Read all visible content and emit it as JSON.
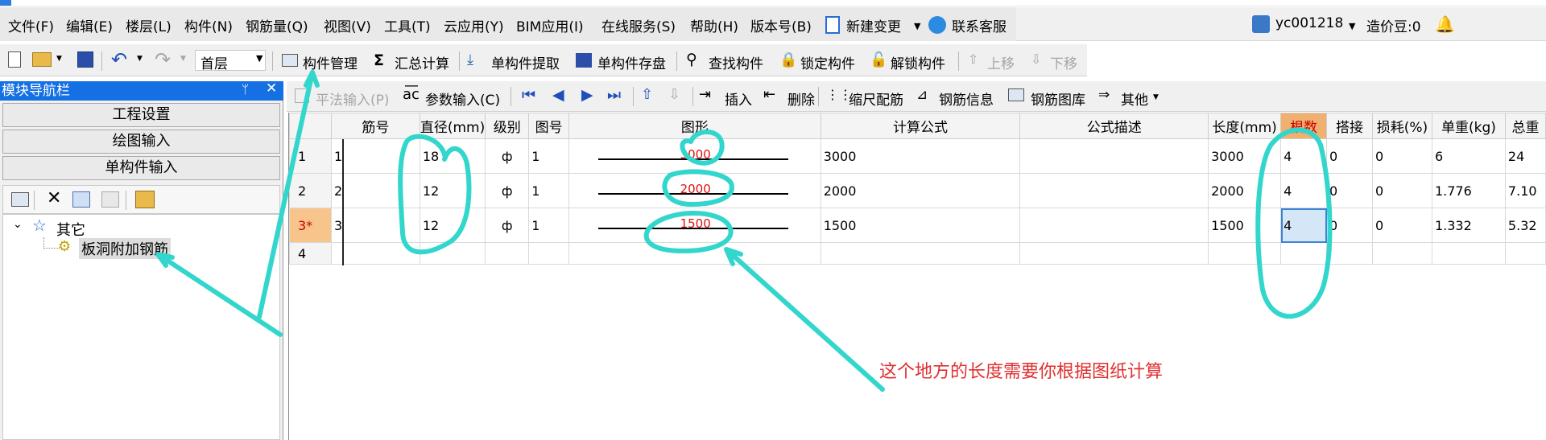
{
  "menu": {
    "items": [
      "文件(F)",
      "编辑(E)",
      "楼层(L)",
      "构件(N)",
      "钢筋量(Q)",
      "视图(V)",
      "工具(T)",
      "云应用(Y)",
      "BIM应用(I)",
      "在线服务(S)",
      "帮助(H)",
      "版本号(B)",
      "新建变更",
      "联系客服"
    ],
    "user": "yc001218",
    "cost_beans": "造价豆:0"
  },
  "toolbar": {
    "floor": "首层",
    "component_manage": "构件管理",
    "summary_calc": "汇总计算",
    "single_extract": "单构件提取",
    "single_save": "单构件存盘",
    "find_component": "查找构件",
    "lock_component": "锁定构件",
    "unlock_component": "解锁构件",
    "move_up": "上移",
    "move_down": "下移"
  },
  "left_panel": {
    "title": "模块导航栏",
    "buttons": [
      "工程设置",
      "绘图输入",
      "单构件输入"
    ],
    "tree": {
      "root": "其它",
      "child": "板洞附加钢筋"
    }
  },
  "grid_toolbar": {
    "flat_input": "平法输入(P)",
    "param_input": "参数输入(C)",
    "insert": "插入",
    "delete": "删除",
    "scale_rebar": "缩尺配筋",
    "rebar_info": "钢筋信息",
    "rebar_library": "钢筋图库",
    "other": "其他"
  },
  "table": {
    "columns": [
      "",
      "筋号",
      "直径(mm)",
      "级别",
      "图号",
      "图形",
      "计算公式",
      "公式描述",
      "长度(mm)",
      "根数",
      "搭接",
      "损耗(%)",
      "单重(kg)",
      "总重"
    ],
    "rows": [
      {
        "row": "1",
        "bar_no": "1",
        "diameter": "18",
        "grade": "ф",
        "fig_no": "1",
        "shape": "3000",
        "formula": "3000",
        "desc": "",
        "length": "3000",
        "count": "4",
        "lap": "0",
        "loss": "0",
        "unit_wt": "6",
        "total_wt": "24"
      },
      {
        "row": "2",
        "bar_no": "2",
        "diameter": "12",
        "grade": "ф",
        "fig_no": "1",
        "shape": "2000",
        "formula": "2000",
        "desc": "",
        "length": "2000",
        "count": "4",
        "lap": "0",
        "loss": "0",
        "unit_wt": "1.776",
        "total_wt": "7.10"
      },
      {
        "row": "3*",
        "bar_no": "3",
        "diameter": "12",
        "grade": "ф",
        "fig_no": "1",
        "shape": "1500",
        "formula": "1500",
        "desc": "",
        "length": "1500",
        "count": "4",
        "lap": "0",
        "loss": "0",
        "unit_wt": "1.332",
        "total_wt": "5.32"
      },
      {
        "row": "4",
        "bar_no": "",
        "diameter": "",
        "grade": "",
        "fig_no": "",
        "shape": "",
        "formula": "",
        "desc": "",
        "length": "",
        "count": "",
        "lap": "",
        "loss": "",
        "unit_wt": "",
        "total_wt": ""
      }
    ]
  },
  "annotation": {
    "note": "这个地方的长度需要你根据图纸计算",
    "color": "#33d6cc"
  },
  "colors": {
    "nav_header": "#1570e3",
    "highlight_header": "#f0b070",
    "shape_text": "#e01010"
  }
}
